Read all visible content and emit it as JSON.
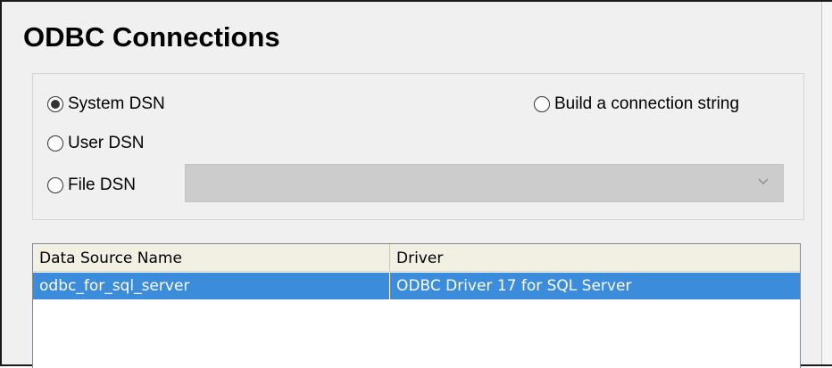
{
  "section": {
    "title": "ODBC Connections"
  },
  "dsn_options": {
    "system_dsn": {
      "label": "System DSN",
      "checked": true
    },
    "user_dsn": {
      "label": "User DSN",
      "checked": false
    },
    "file_dsn": {
      "label": "File DSN",
      "checked": false
    },
    "build_connection_string": {
      "label": "Build a connection string",
      "checked": false
    }
  },
  "file_dsn_select": {
    "value": "",
    "icon": "chevron-down-icon"
  },
  "table": {
    "columns": [
      "Data Source Name",
      "Driver"
    ],
    "rows": [
      {
        "name": "odbc_for_sql_server",
        "driver": "ODBC Driver 17 for SQL Server",
        "selected": true
      }
    ]
  },
  "colors": {
    "selection": "#3b8cdb",
    "header_bg": "#f2f0e3",
    "window_bg": "#f0f0f0"
  }
}
